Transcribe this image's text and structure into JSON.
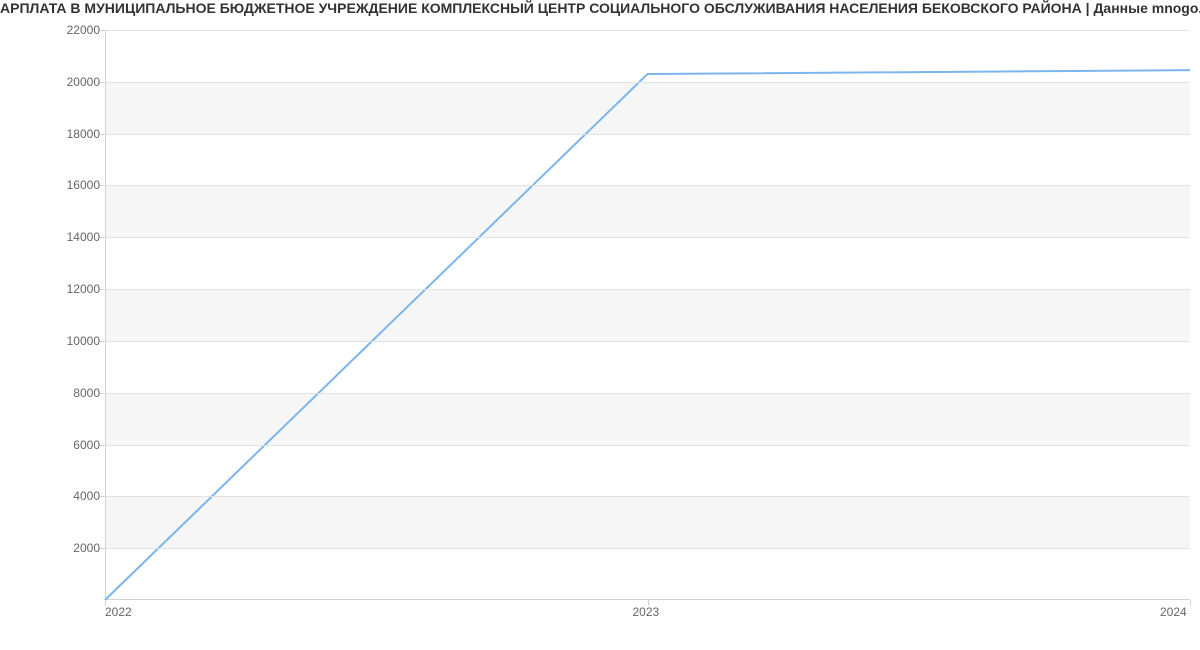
{
  "chart_data": {
    "type": "line",
    "title": "АРПЛАТА В МУНИЦИПАЛЬНОЕ БЮДЖЕТНОЕ УЧРЕЖДЕНИЕ КОМПЛЕКСНЫЙ ЦЕНТР СОЦИАЛЬНОГО ОБСЛУЖИВАНИЯ НАСЕЛЕНИЯ БЕКОВСКОГО РАЙОНА | Данные mnogo.wo",
    "x": [
      2022,
      2023,
      2024
    ],
    "y": [
      0,
      20300,
      20450
    ],
    "x_ticks": [
      2022,
      2023,
      2024
    ],
    "y_ticks": [
      2000,
      4000,
      6000,
      8000,
      10000,
      12000,
      14000,
      16000,
      18000,
      20000,
      22000
    ],
    "xlim": [
      2022,
      2024
    ],
    "ylim": [
      0,
      22000
    ],
    "line_color": "#7cb5ec",
    "xlabel": "",
    "ylabel": ""
  }
}
